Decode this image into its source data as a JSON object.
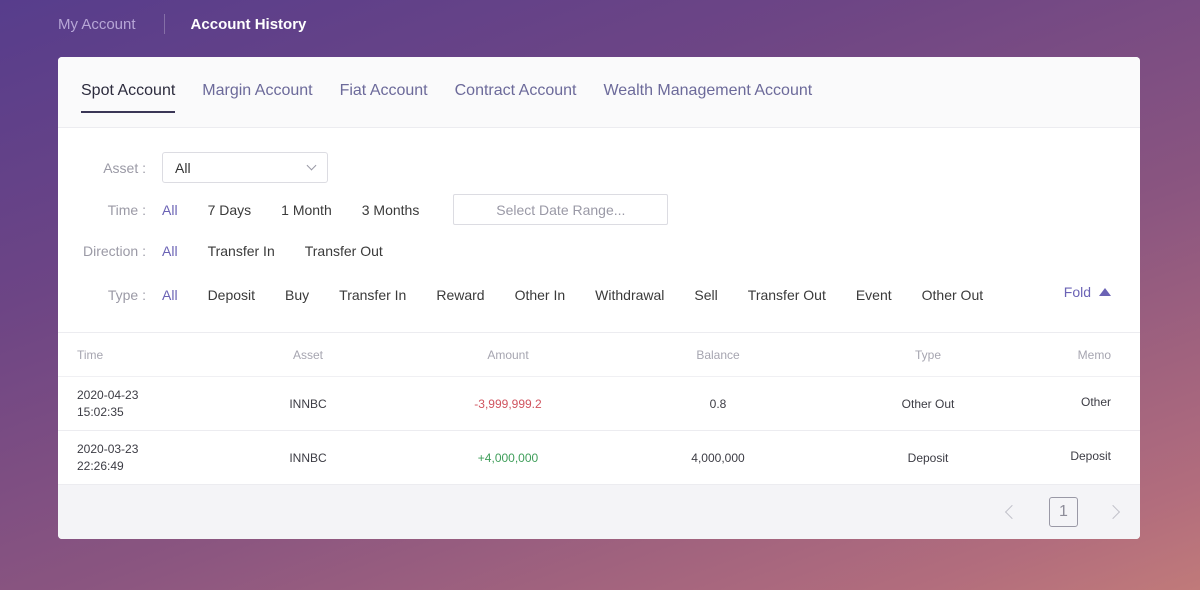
{
  "topnav": {
    "my_account": "My Account",
    "account_history": "Account History"
  },
  "tabs": [
    {
      "label": "Spot Account",
      "active": true
    },
    {
      "label": "Margin Account",
      "active": false
    },
    {
      "label": "Fiat Account",
      "active": false
    },
    {
      "label": "Contract Account",
      "active": false
    },
    {
      "label": "Wealth Management Account",
      "active": false
    }
  ],
  "filters": {
    "asset": {
      "label": "Asset :",
      "selected": "All"
    },
    "time": {
      "label": "Time :",
      "options": [
        "All",
        "7 Days",
        "1 Month",
        "3 Months"
      ],
      "active": "All",
      "date_range_placeholder": "Select Date Range..."
    },
    "direction": {
      "label": "Direction :",
      "options": [
        "All",
        "Transfer In",
        "Transfer Out"
      ],
      "active": "All"
    },
    "type": {
      "label": "Type :",
      "options": [
        "All",
        "Deposit",
        "Buy",
        "Transfer In",
        "Reward",
        "Other In",
        "Withdrawal",
        "Sell",
        "Transfer Out",
        "Event",
        "Other Out"
      ],
      "active": "All"
    },
    "fold_label": "Fold"
  },
  "table": {
    "columns": [
      "Time",
      "Asset",
      "Amount",
      "Balance",
      "Type",
      "Memo"
    ],
    "rows": [
      {
        "date": "2020-04-23",
        "time": "15:02:35",
        "asset": "INNBC",
        "amount": "-3,999,999.2",
        "direction": "negative",
        "balance": "0.8",
        "type": "Other Out",
        "memo": "Other"
      },
      {
        "date": "2020-03-23",
        "time": "22:26:49",
        "asset": "INNBC",
        "amount": "+4,000,000",
        "direction": "positive",
        "balance": "4,000,000",
        "type": "Deposit",
        "memo": "Deposit"
      }
    ]
  },
  "pagination": {
    "current_page": "1"
  },
  "colors": {
    "accent": "#6b63b5",
    "negative": "#d0545f",
    "positive": "#3f9e5a"
  }
}
